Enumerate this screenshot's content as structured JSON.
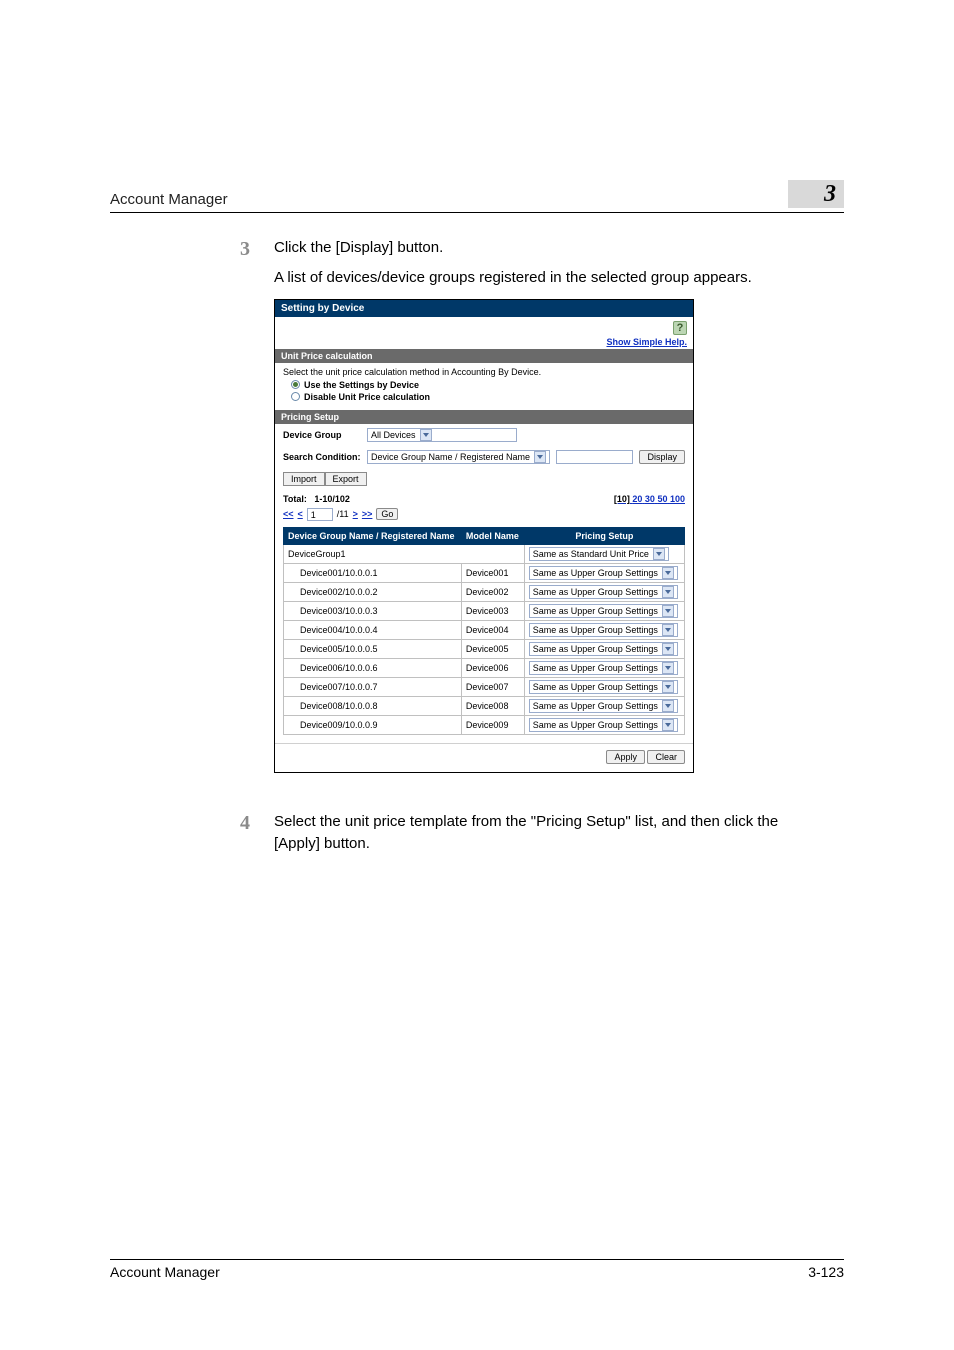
{
  "page_header": "Account Manager",
  "chapter_number": "3",
  "footer_left": "Account Manager",
  "footer_right": "3-123",
  "steps": {
    "s3": {
      "num": "3",
      "text": "Click the [Display] button.",
      "body": "A list of devices/device groups  registered in the selected group appears."
    },
    "s4": {
      "num": "4",
      "text": "Select the unit price template from the \"Pricing Setup\" list, and then click the [Apply] button."
    }
  },
  "panel": {
    "title": "Setting by Device",
    "help": "?",
    "simple_help": "Show Simple Help.",
    "unit_price_section": "Unit Price calculation",
    "unit_price_desc": "Select the unit price calculation method in Accounting By Device.",
    "radio1": "Use the Settings by Device",
    "radio2": "Disable Unit Price calculation",
    "pricing_section": "Pricing Setup",
    "device_group_label": "Device Group",
    "device_group_value": "All Devices",
    "search_cond_label": "Search Condition:",
    "search_cond_value": "Device Group Name / Registered Name",
    "display_btn": "Display",
    "import_btn": "Import",
    "export_btn": "Export",
    "total_label": "Total:",
    "total_value": "1-10/102",
    "page_sizes": [
      "[10]",
      "20",
      "30",
      "50",
      "100"
    ],
    "pager_prev2": "<<",
    "pager_prev1": "<",
    "pager_cur": "1",
    "pager_of": "/11",
    "pager_next1": ">",
    "pager_next2": ">>",
    "pager_go": "Go",
    "col_group": "Device Group Name / Registered Name",
    "col_model": "Model Name",
    "col_pricing": "Pricing Setup",
    "group_row_name": "DeviceGroup1",
    "group_row_ps": "Same as Standard Unit Price",
    "child_ps": "Same as Upper Group Settings",
    "rows": [
      {
        "name": "Device001/10.0.0.1",
        "model": "Device001"
      },
      {
        "name": "Device002/10.0.0.2",
        "model": "Device002"
      },
      {
        "name": "Device003/10.0.0.3",
        "model": "Device003"
      },
      {
        "name": "Device004/10.0.0.4",
        "model": "Device004"
      },
      {
        "name": "Device005/10.0.0.5",
        "model": "Device005"
      },
      {
        "name": "Device006/10.0.0.6",
        "model": "Device006"
      },
      {
        "name": "Device007/10.0.0.7",
        "model": "Device007"
      },
      {
        "name": "Device008/10.0.0.8",
        "model": "Device008"
      },
      {
        "name": "Device009/10.0.0.9",
        "model": "Device009"
      }
    ],
    "apply_btn": "Apply",
    "clear_btn": "Clear"
  }
}
